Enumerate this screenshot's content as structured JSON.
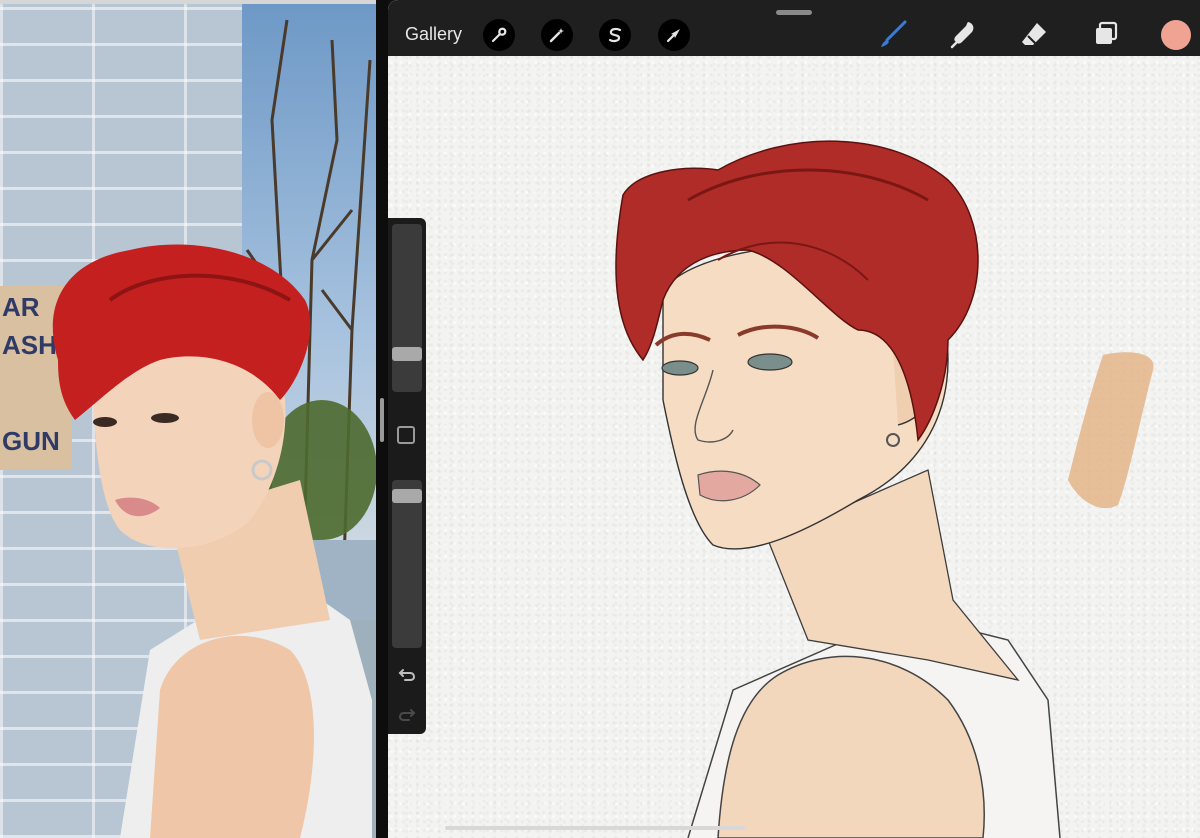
{
  "toolbar": {
    "gallery_label": "Gallery",
    "left_tools": [
      {
        "name": "actions",
        "icon": "wrench-icon"
      },
      {
        "name": "adjustments",
        "icon": "magic-wand-icon"
      },
      {
        "name": "selection",
        "icon": "selection-s-icon"
      },
      {
        "name": "transform",
        "icon": "arrow-cursor-icon"
      }
    ],
    "right_tools": [
      {
        "name": "brush",
        "icon": "brush-icon",
        "active": true
      },
      {
        "name": "smudge",
        "icon": "smudge-icon",
        "active": false
      },
      {
        "name": "eraser",
        "icon": "eraser-icon",
        "active": false
      },
      {
        "name": "layers",
        "icon": "layers-icon",
        "active": false
      }
    ],
    "current_color": "#f1a393",
    "active_tool_color": "#3a7bd5"
  },
  "sidebar": {
    "brush_size_level": 0.2,
    "opacity_level": 0.94,
    "buttons": [
      "modify-button",
      "undo-icon",
      "redo-icon"
    ]
  },
  "reference_photo": {
    "poster_text": [
      "AR",
      "ASH",
      "GUN"
    ]
  },
  "colors": {
    "hair": "#b32a2a",
    "skin": "#f0d2b2",
    "paper": "#f3f3f1",
    "toolbar_bg": "#1f1f1f"
  }
}
